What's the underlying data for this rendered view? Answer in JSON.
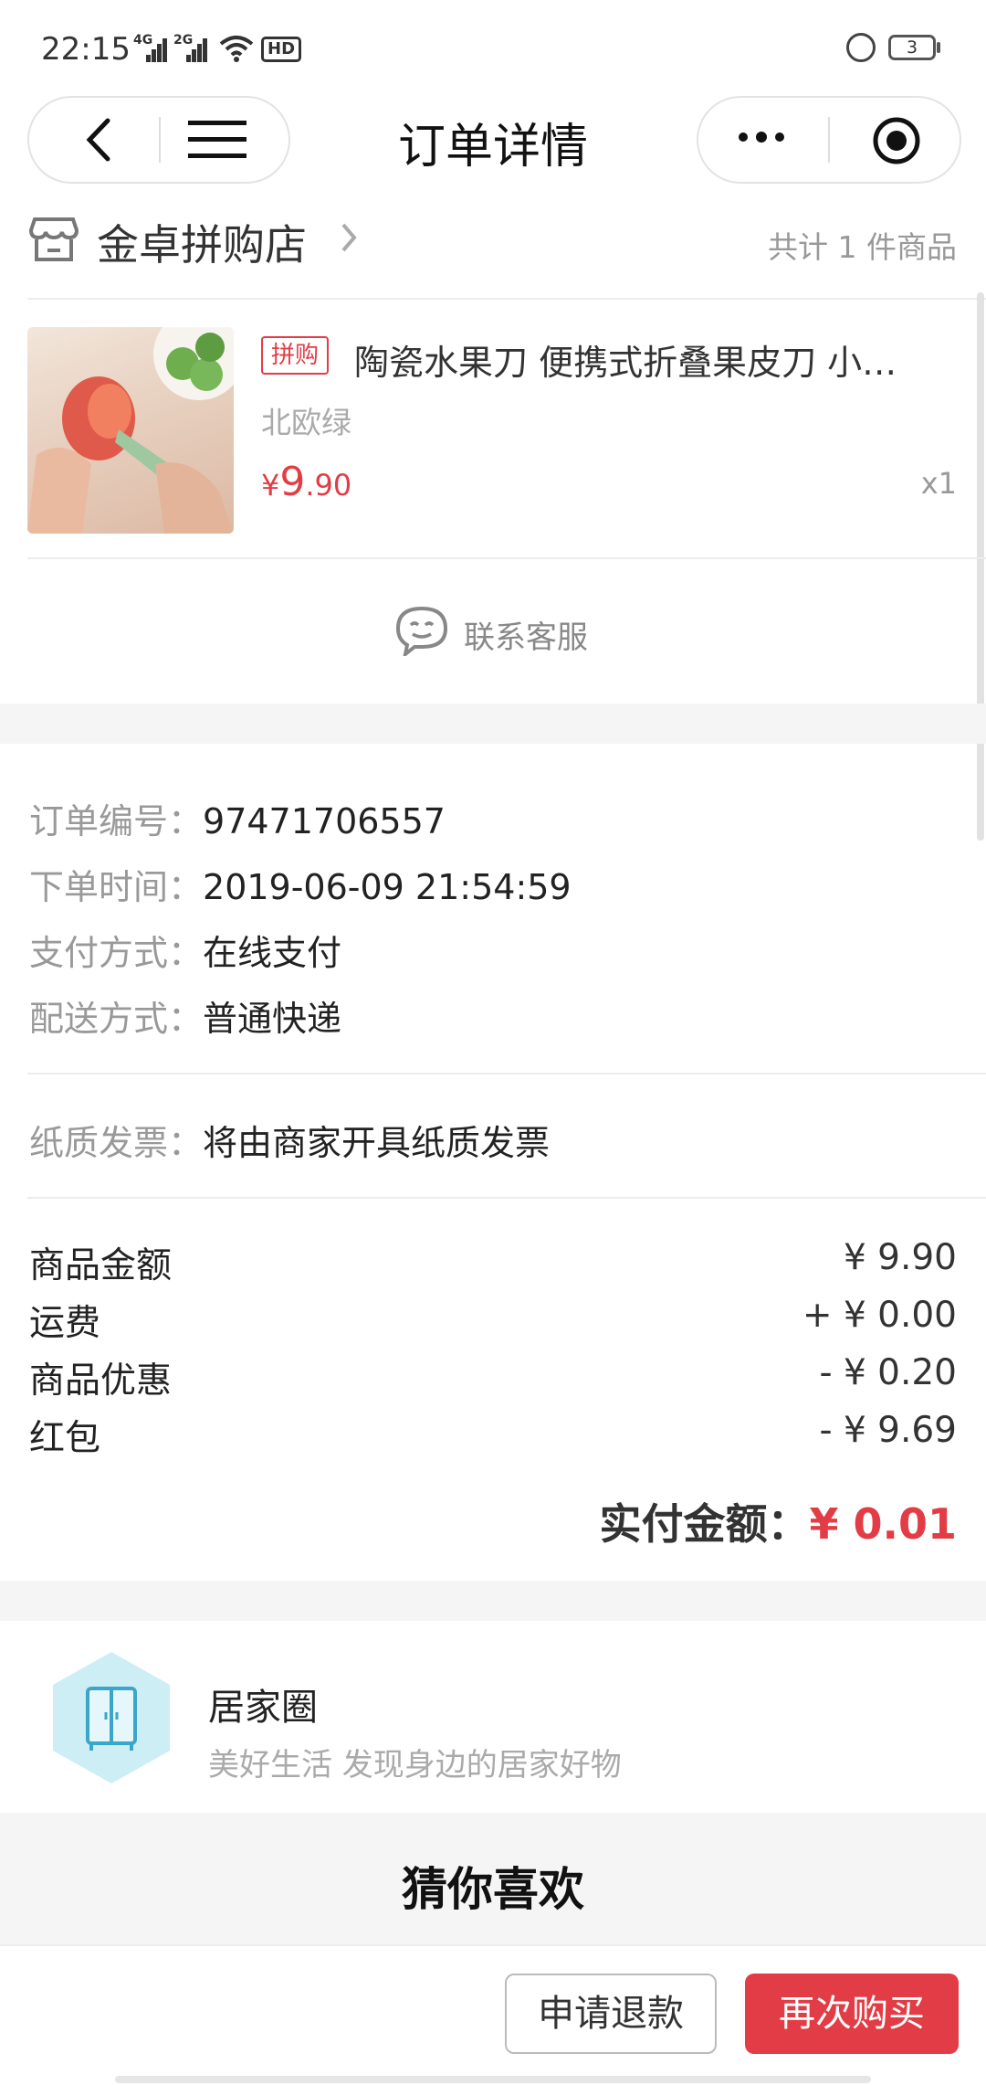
{
  "status_bar": {
    "time": "22:15",
    "signal1_label": "4G",
    "signal2_label": "2G",
    "hd_label": "HD",
    "battery": "3"
  },
  "nav": {
    "title": "订单详情"
  },
  "shop": {
    "name": "金卓拼购店",
    "count_text": "共计 1 件商品"
  },
  "product": {
    "tag": "拼购",
    "name": "陶瓷水果刀 便携式折叠果皮刀 小…",
    "variant": "北欧绿",
    "price_symbol": "¥",
    "price_int": "9",
    "price_dec": ".90",
    "qty": "x1"
  },
  "service": {
    "label": "联系客服"
  },
  "order_info": [
    {
      "label": "订单编号：",
      "value": "97471706557"
    },
    {
      "label": "下单时间：",
      "value": "2019-06-09 21:54:59"
    },
    {
      "label": "支付方式：",
      "value": "在线支付"
    },
    {
      "label": "配送方式：",
      "value": "普通快递"
    }
  ],
  "invoice": {
    "label": "纸质发票：",
    "value": "将由商家开具纸质发票"
  },
  "summary": [
    {
      "label": "商品金额",
      "value": "¥ 9.90"
    },
    {
      "label": "运费",
      "value": "+ ¥ 0.00"
    },
    {
      "label": "商品优惠",
      "value": "- ¥ 0.20"
    },
    {
      "label": "红包",
      "value": "- ¥ 9.69"
    }
  ],
  "paid": {
    "label": "实付金额：",
    "value": "¥ 0.01"
  },
  "circle": {
    "title": "居家圈",
    "subtitle": "美好生活 发现身边的居家好物"
  },
  "guess": {
    "title": "猜你喜欢"
  },
  "actions": {
    "refund": "申请退款",
    "rebuy": "再次购买"
  },
  "colors": {
    "accent": "#e23d46",
    "secondary_text": "#999999"
  }
}
